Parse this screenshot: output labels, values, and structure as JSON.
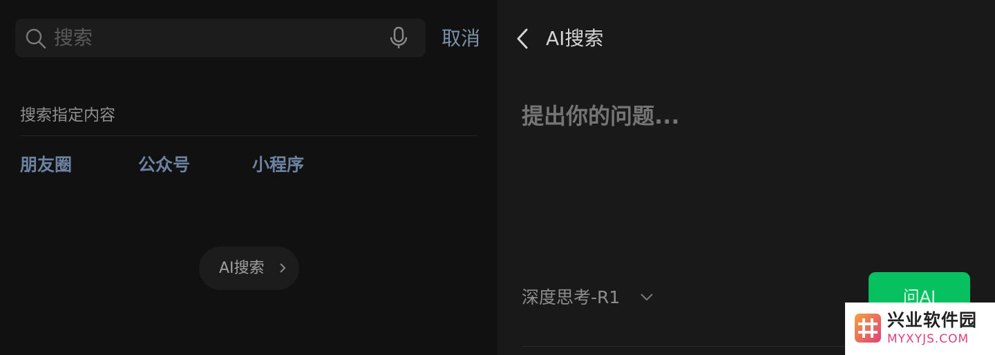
{
  "left": {
    "search": {
      "placeholder": "搜索",
      "cancel_label": "取消"
    },
    "section_title": "搜索指定内容",
    "categories": [
      "朋友圈",
      "公众号",
      "小程序"
    ],
    "ai_pill_label": "AI搜索"
  },
  "right": {
    "title": "AI搜索",
    "question_placeholder": "提出你的问题...",
    "model_label": "深度思考-R1",
    "ask_button_label": "问AI"
  },
  "watermark": {
    "name": "兴业软件园",
    "domain": "MYXYJS.COM"
  },
  "colors": {
    "accent_blue": "#6d82a1",
    "ask_green": "#07c160",
    "watermark_pink": "#e0407a"
  },
  "icons": [
    "search-icon",
    "mic-icon",
    "chevron-right-icon",
    "back-icon",
    "chevron-down-icon"
  ]
}
